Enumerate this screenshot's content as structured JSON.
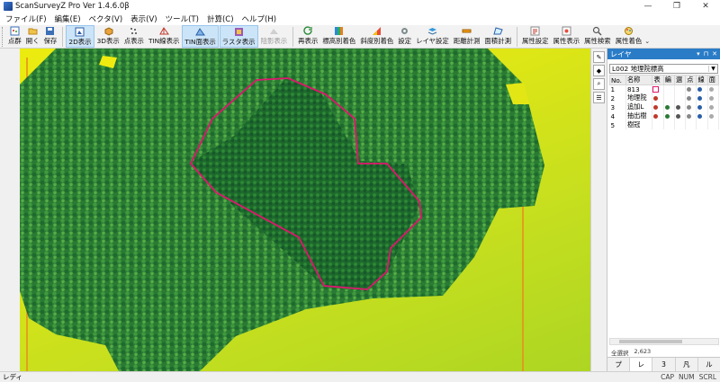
{
  "window": {
    "title": "ScanSurveyZ Pro  Ver 1.4.6.0β",
    "minimize": "—",
    "restore": "❐",
    "close": "✕"
  },
  "menu": [
    "ファイル(F)",
    "編集(E)",
    "ベクタ(V)",
    "表示(V)",
    "ツール(T)",
    "計算(C)",
    "ヘルプ(H)"
  ],
  "toolbar": {
    "group1": [
      "点群",
      "開く",
      "保存"
    ],
    "group2": [
      "2D表示",
      "3D表示",
      "点表示",
      "TIN線表示",
      "TIN面表示",
      "ラスタ表示",
      "陰影表示"
    ],
    "group3": [
      "再表示",
      "標高別着色",
      "斜度別着色",
      "設定",
      "レイヤ設定",
      "距離計測",
      "面積計測"
    ],
    "group4": [
      "属性設定",
      "属性表示",
      "属性検索",
      "属性着色"
    ],
    "overflow": "⌄"
  },
  "panel": {
    "title": "レイヤ",
    "controls": [
      "▾",
      "⊓",
      "✕"
    ],
    "selected_layer": "L002 地理院標高",
    "columns": [
      "No.",
      "名称",
      "表",
      "編",
      "選",
      "点",
      "線",
      "面"
    ],
    "rows": [
      {
        "no": "1",
        "name": "813"
      },
      {
        "no": "2",
        "name": "地理院"
      },
      {
        "no": "3",
        "name": "追加L"
      },
      {
        "no": "4",
        "name": "抽出樹"
      },
      {
        "no": "5",
        "name": "樹冠"
      }
    ],
    "status": [
      "全選択",
      "2,623"
    ],
    "tabs": [
      "プ",
      "レ",
      "3",
      "凡",
      "ル"
    ]
  },
  "status": {
    "text": "レディ",
    "indicators": [
      "CAP",
      "NUM",
      "SCRL"
    ]
  },
  "colors": {
    "accent": "#2a7cc7",
    "boundary": "#e0166e",
    "raster_yellow": "#f4ef0b",
    "raster_green": "#8ccb2c",
    "forest_dark": "#1f6b2e"
  }
}
